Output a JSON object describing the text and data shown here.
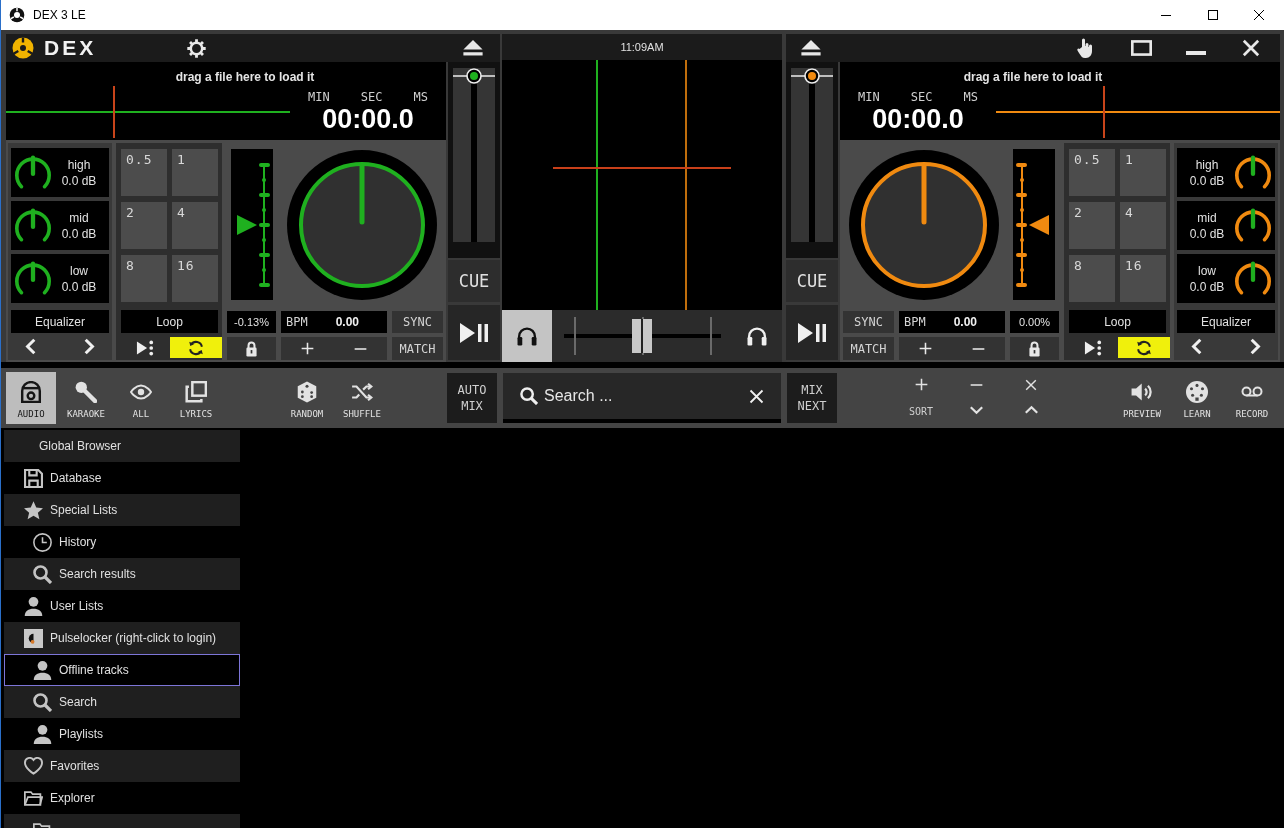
{
  "window": {
    "title": "DEX 3 LE"
  },
  "decks": [
    {
      "kind": "left",
      "color": "#1fb01f",
      "brand": "DEX",
      "drop_hint": "drag a file here to load it",
      "time_units": [
        "MIN",
        "SEC",
        "MS"
      ],
      "time": "00:00.0",
      "volume": {
        "level": 1
      },
      "cue": "CUE",
      "eq": [
        {
          "band": "high",
          "gain": "0.0 dB"
        },
        {
          "band": "mid",
          "gain": "0.0 dB"
        },
        {
          "band": "low",
          "gain": "0.0 dB"
        }
      ],
      "eq_label": "Equalizer",
      "loop_pads": [
        "0.5",
        "1",
        "2",
        "4",
        "8",
        "16"
      ],
      "loop_label": "Loop",
      "loop_on": true,
      "pitch_fader": {
        "level": 0.5
      },
      "pitch": "-0.13%",
      "bpm_label": "BPM",
      "bpm": "0.00",
      "sync": "SYNC",
      "match": "MATCH"
    },
    {
      "kind": "right",
      "color": "#f08a10",
      "drop_hint": "drag a file here to load it",
      "time_units": [
        "MIN",
        "SEC",
        "MS"
      ],
      "time": "00:00.0",
      "volume": {
        "level": 1
      },
      "cue": "CUE",
      "eq": [
        {
          "band": "high",
          "gain": "0.0 dB"
        },
        {
          "band": "mid",
          "gain": "0.0 dB"
        },
        {
          "band": "low",
          "gain": "0.0 dB"
        }
      ],
      "eq_label": "Equalizer",
      "loop_pads": [
        "0.5",
        "1",
        "2",
        "4",
        "8",
        "16"
      ],
      "loop_label": "Loop",
      "loop_on": true,
      "pitch_fader": {
        "level": 0.5
      },
      "pitch": "0.00%",
      "bpm_label": "BPM",
      "bpm": "0.00",
      "sync": "SYNC",
      "match": "MATCH"
    }
  ],
  "mixer": {
    "clock": "11:09AM",
    "headphones": [
      {
        "selected": true
      },
      {
        "selected": false
      }
    ],
    "crossfader": {
      "level": 0.5
    }
  },
  "toolbar": {
    "modes": [
      {
        "kind": "audio",
        "label": "AUDIO",
        "selected": true
      },
      {
        "kind": "karaoke",
        "label": "KARAOKE",
        "selected": false
      },
      {
        "kind": "all",
        "label": "ALL",
        "selected": false
      },
      {
        "kind": "lyrics",
        "label": "LYRICS",
        "selected": false
      }
    ],
    "actions": [
      {
        "kind": "random",
        "label": "RANDOM"
      },
      {
        "kind": "shuffle",
        "label": "SHUFFLE"
      }
    ],
    "auto_mix": "AUTO MIX",
    "search": {
      "placeholder": "Search ..."
    },
    "mix_next": "MIX NEXT",
    "sort_label": "SORT",
    "tools": [
      {
        "kind": "preview",
        "label": "PREVIEW"
      },
      {
        "kind": "learn",
        "label": "LEARN"
      },
      {
        "kind": "record",
        "label": "RECORD"
      }
    ]
  },
  "sidebar": {
    "header": "Global Browser",
    "items": [
      {
        "kind": "database",
        "label": "Database",
        "selected": false
      },
      {
        "kind": "list",
        "label": "Special Lists",
        "selected": false,
        "children": [
          {
            "kind": "history",
            "label": "History",
            "selected": false
          },
          {
            "kind": "search",
            "label": "Search results",
            "selected": false
          }
        ]
      },
      {
        "kind": "user",
        "label": "User Lists",
        "selected": false
      },
      {
        "kind": "service",
        "label": "Pulselocker (right-click to login)",
        "selected": false,
        "children": [
          {
            "kind": "user",
            "label": "Offline tracks",
            "selected": true
          },
          {
            "kind": "search",
            "label": "Search",
            "selected": false
          },
          {
            "kind": "user",
            "label": "Playlists",
            "selected": false
          }
        ]
      },
      {
        "kind": "favorites",
        "label": "Favorites",
        "selected": false
      },
      {
        "kind": "folder",
        "label": "Explorer",
        "selected": false,
        "children": [
          {
            "kind": "folder",
            "selected": false
          }
        ]
      }
    ]
  }
}
